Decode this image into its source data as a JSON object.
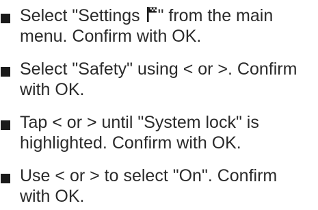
{
  "steps": [
    {
      "lines": [
        {
          "before_icon": "Select  \"Settings ",
          "icon": "settings-flag-icon",
          "after_icon": "\" from the main"
        },
        "menu. Confirm with OK."
      ]
    },
    {
      "lines": [
        "Select \"Safety\" using < or >. Confirm",
        "with OK."
      ]
    },
    {
      "lines": [
        "Tap < or > until \"System lock\" is",
        "highlighted. Confirm with OK."
      ]
    },
    {
      "lines": [
        "Use < or > to select \"On\". Confirm",
        "with OK."
      ]
    }
  ],
  "colors": {
    "text": "#2a2a2a",
    "bullet": "#1a1a1a",
    "background": "#ffffff"
  }
}
